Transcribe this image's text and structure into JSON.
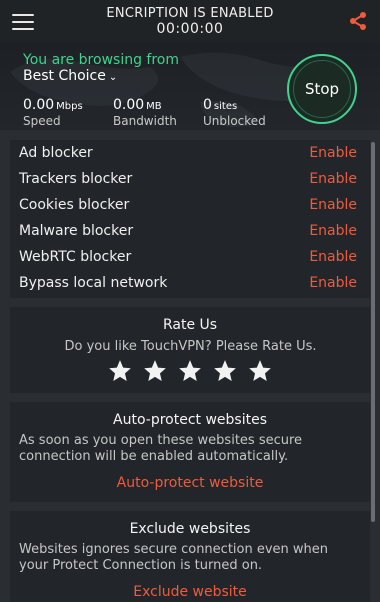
{
  "header": {
    "status": "ENCRIPTION IS ENABLED",
    "timer": "00:00:00"
  },
  "connection": {
    "browsing_label": "You are browsing from",
    "location": "Best Choice",
    "stats": [
      {
        "value": "0.00",
        "unit": "Mbps",
        "label": "Speed"
      },
      {
        "value": "0.00",
        "unit": "MB",
        "label": "Bandwidth"
      },
      {
        "value": "0",
        "unit": "sites",
        "label": "Unblocked"
      }
    ],
    "stop_label": "Stop"
  },
  "blockers": [
    {
      "name": "Ad blocker",
      "action": "Enable"
    },
    {
      "name": "Trackers blocker",
      "action": "Enable"
    },
    {
      "name": "Cookies blocker",
      "action": "Enable"
    },
    {
      "name": "Malware blocker",
      "action": "Enable"
    },
    {
      "name": "WebRTC blocker",
      "action": "Enable"
    },
    {
      "name": "Bypass local network",
      "action": "Enable"
    }
  ],
  "rate": {
    "title": "Rate Us",
    "text": "Do you like TouchVPN? Please Rate Us.",
    "stars": 5
  },
  "auto_protect": {
    "title": "Auto-protect websites",
    "text_1": "As soon as you open these websites secure",
    "text_2": "connection will be enabled automatically.",
    "link": "Auto-protect website"
  },
  "exclude": {
    "title": "Exclude websites",
    "text_1": "Websites ignores secure connection even when",
    "text_2": "your Protect Connection is turned on.",
    "link": "Exclude website"
  },
  "colors": {
    "accent_green": "#3fd38e",
    "accent_orange": "#ef5b3c",
    "background": "#2a2e33",
    "card": "#22262a"
  }
}
